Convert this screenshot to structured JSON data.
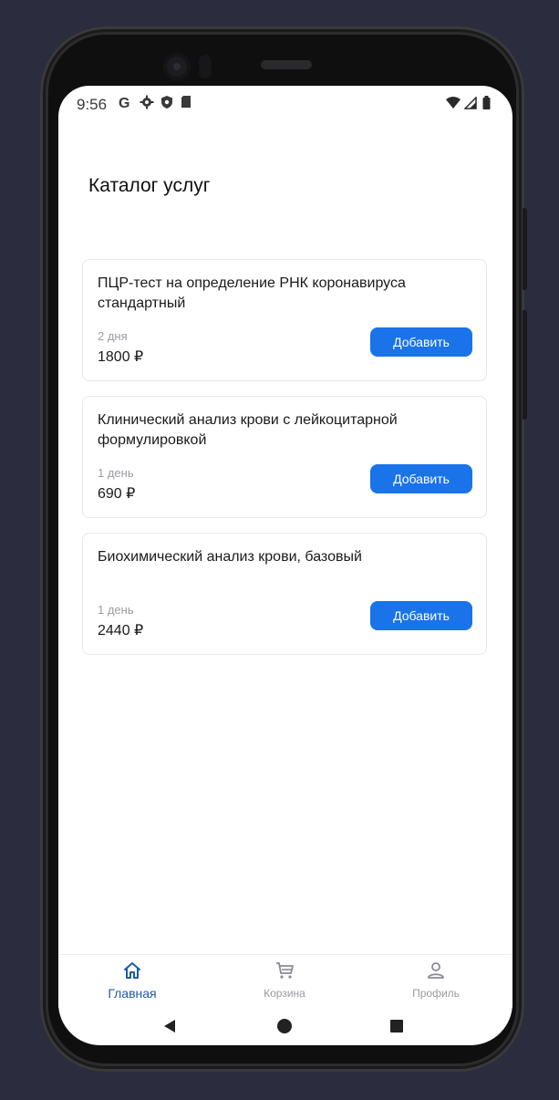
{
  "status_bar": {
    "time": "9:56",
    "left_icons": [
      "google-icon",
      "gear-icon",
      "shield-icon",
      "sd-card-icon"
    ],
    "right_icons": [
      "wifi-icon",
      "signal-icon",
      "battery-icon"
    ]
  },
  "page": {
    "title": "Каталог услуг"
  },
  "catalog": {
    "items": [
      {
        "name": "ПЦР-тест на определение РНК коронавируса стандартный",
        "duration": "2 дня",
        "price": "1800 ₽",
        "button": "Добавить"
      },
      {
        "name": "Клинический анализ крови с лейкоцитарной формулировкой",
        "duration": "1 день",
        "price": "690 ₽",
        "button": "Добавить"
      },
      {
        "name": "Биохимический анализ крови, базовый",
        "duration": "1 день",
        "price": "2440 ₽",
        "button": "Добавить"
      }
    ]
  },
  "nav": {
    "items": [
      {
        "label": "Главная",
        "icon": "home-icon",
        "active": true
      },
      {
        "label": "Корзина",
        "icon": "cart-icon",
        "active": false
      },
      {
        "label": "Профиль",
        "icon": "profile-icon",
        "active": false
      }
    ]
  },
  "colors": {
    "accent": "#1a73e8",
    "active_nav": "#1e5aa8",
    "background": "#2b2d3e"
  }
}
